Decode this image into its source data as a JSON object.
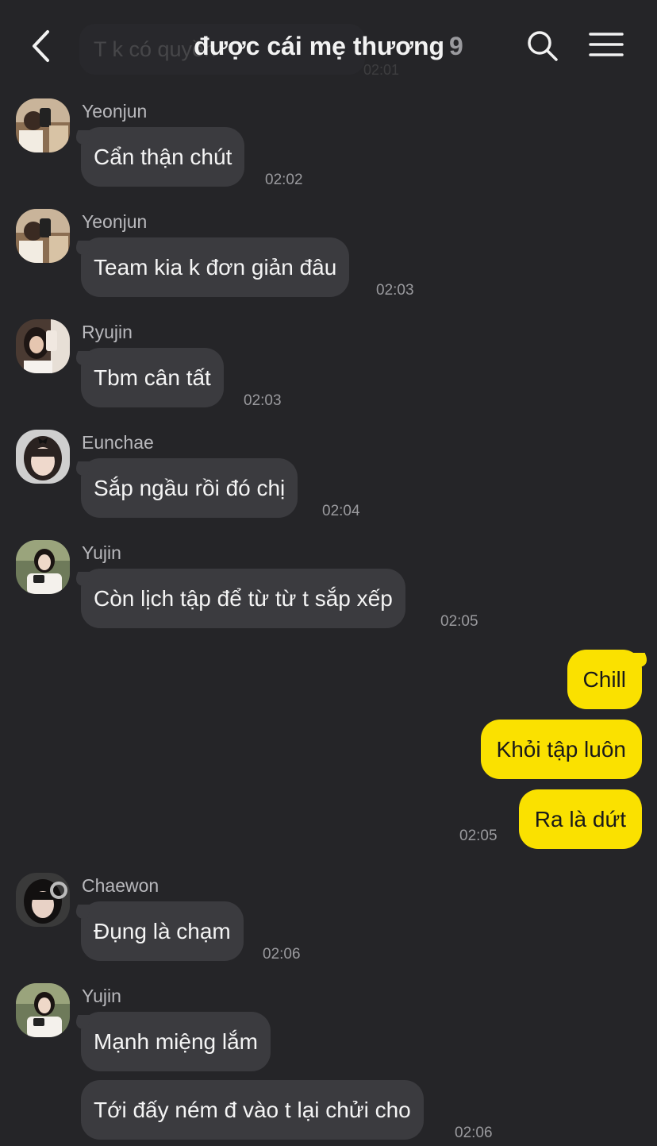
{
  "header": {
    "title": "được cái mẹ thương",
    "member_count": "9",
    "ghost_preview": "T k có quyền",
    "ghost_time": "02:01"
  },
  "colors": {
    "background": "#252528",
    "incoming_bubble": "#3b3b3f",
    "outgoing_bubble": "#fae100"
  },
  "messages": [
    {
      "sender": "Yeonjun",
      "text": "Cẩn thận chút",
      "time": "02:02"
    },
    {
      "sender": "Yeonjun",
      "text": "Team kia k đơn giản đâu",
      "time": "02:03"
    },
    {
      "sender": "Ryujin",
      "text": "Tbm cân tất",
      "time": "02:03"
    },
    {
      "sender": "Eunchae",
      "text": "Sắp ngầu rồi đó chị",
      "time": "02:04"
    },
    {
      "sender": "Yujin",
      "text": "Còn lịch tập để từ từ t sắp xếp",
      "time": "02:05"
    },
    {
      "sender": "Chaewon",
      "text": "Đụng là chạm",
      "time": "02:06"
    },
    {
      "sender": "Yujin",
      "text": "Mạnh miệng lắm",
      "text2": "Tới đấy ném đ vào t lại chửi cho",
      "time": "02:06"
    }
  ],
  "outgoing": {
    "texts": [
      "Chill",
      "Khỏi tập luôn",
      "Ra là dứt"
    ],
    "time": "02:05"
  }
}
